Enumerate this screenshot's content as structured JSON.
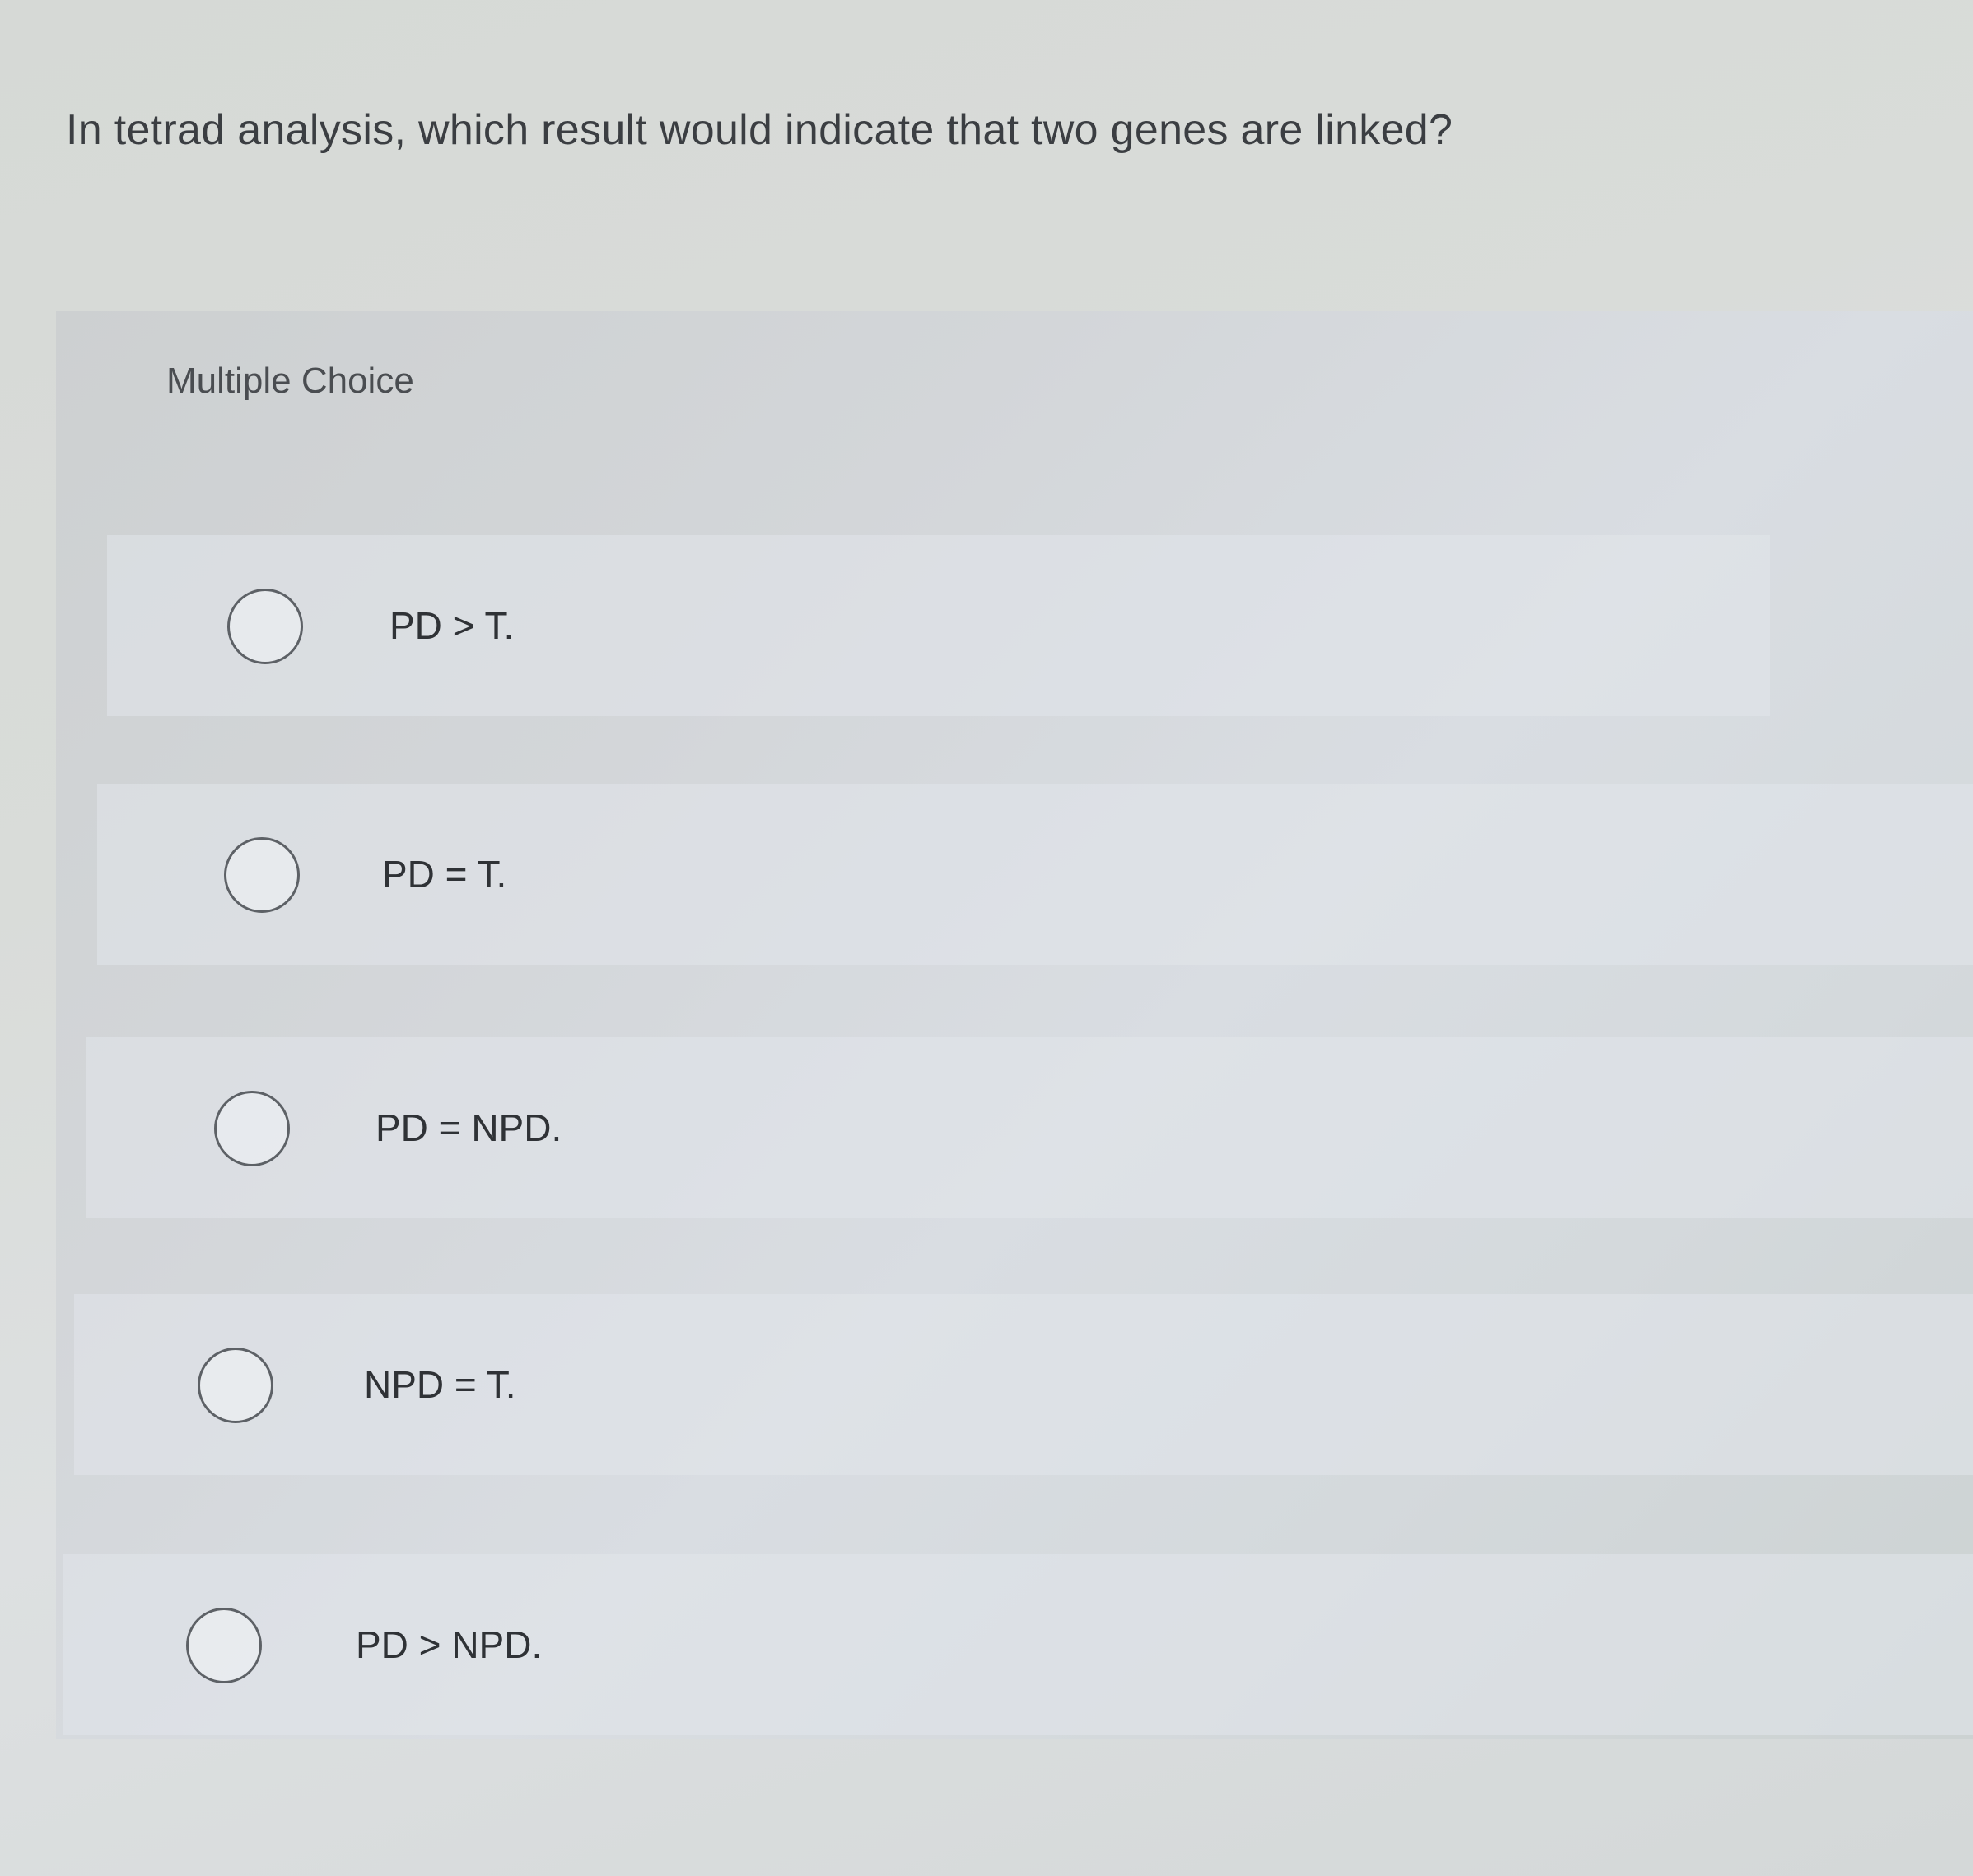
{
  "question": {
    "text": "In tetrad analysis, which result would indicate that two genes are linked?"
  },
  "multiple_choice": {
    "label": "Multiple Choice",
    "options": [
      {
        "text": "PD > T.",
        "selected": false
      },
      {
        "text": "PD = T.",
        "selected": false
      },
      {
        "text": "PD = NPD.",
        "selected": false
      },
      {
        "text": "NPD = T.",
        "selected": false
      },
      {
        "text": "PD > NPD.",
        "selected": false
      }
    ]
  }
}
